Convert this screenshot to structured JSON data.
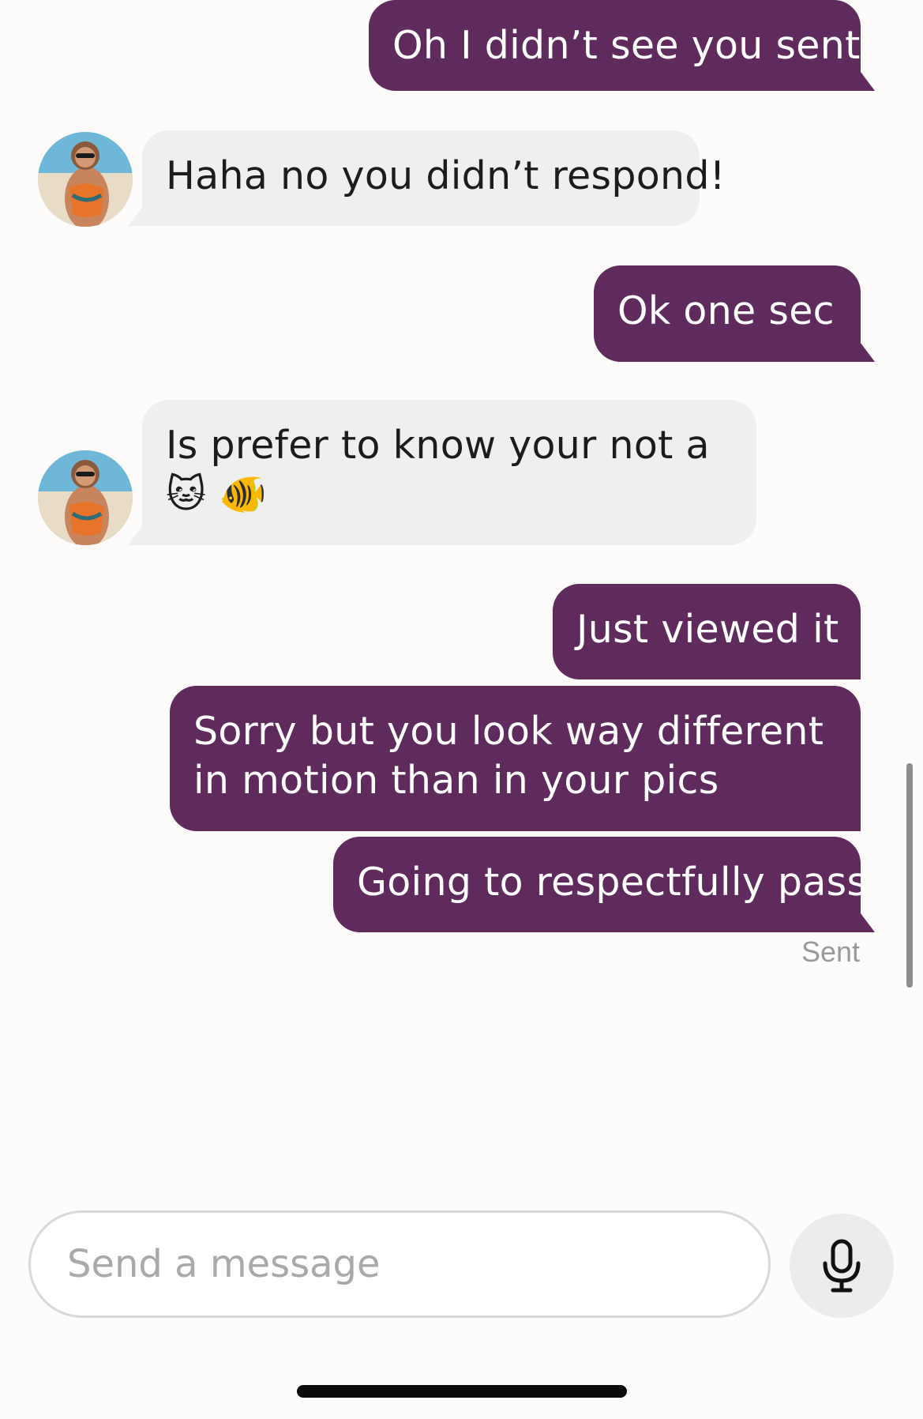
{
  "messages": [
    {
      "direction": "outgoing",
      "text": "Oh I didn’t see you sent"
    },
    {
      "direction": "incoming",
      "text": "Haha no you didn’t respond!"
    },
    {
      "direction": "outgoing",
      "text": "Ok one sec"
    },
    {
      "direction": "incoming",
      "text": "Is prefer to know your not a 🐱 🐠"
    },
    {
      "direction": "outgoing",
      "text": "Just viewed it"
    },
    {
      "direction": "outgoing",
      "text": "Sorry but you look way different in motion than in your pics"
    },
    {
      "direction": "outgoing",
      "text": "Going to respectfully pass"
    }
  ],
  "status": "Sent",
  "composer": {
    "placeholder": "Send a message",
    "value": ""
  },
  "icons": {
    "mic": "microphone-icon",
    "avatar": "contact-avatar"
  },
  "colors": {
    "outgoing_bubble": "#5f2b5c",
    "incoming_bubble": "#efefef",
    "background": "#fdfcfb"
  }
}
